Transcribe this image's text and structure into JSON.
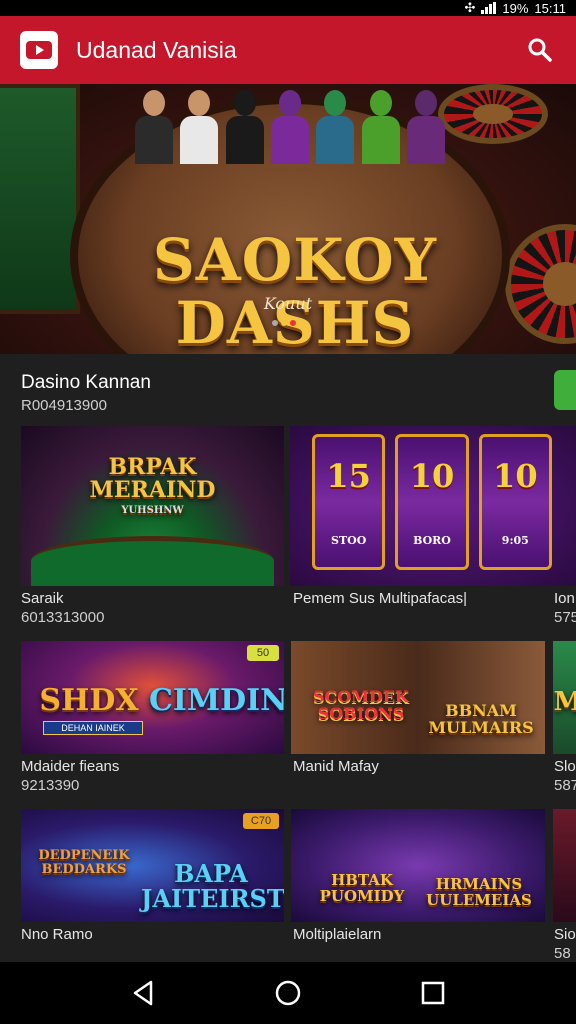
{
  "status_bar": {
    "battery_percent": "19%",
    "time": "15:11"
  },
  "app_bar": {
    "title": "Udanad Vanisia"
  },
  "hero": {
    "title_line1": "SAOKOY",
    "title_line2": "DASHS",
    "subtitle": "Kouut"
  },
  "section": {
    "title": "Dasino Kannan",
    "subtitle": "R004913900"
  },
  "tiles": [
    {
      "art_text": "BRPAK MERAIND",
      "art_sub": "YUHSHNW",
      "badge": "",
      "caption": "Saraik",
      "sub": "6013313000"
    },
    {
      "art_text": "",
      "reels": [
        {
          "num": "15",
          "lbl": "STOO"
        },
        {
          "num": "10",
          "lbl": "BORO"
        },
        {
          "num": "10",
          "lbl": "9:05"
        }
      ],
      "caption": "Pemem Sus Multipafacas|",
      "sub": ""
    },
    {
      "art_text": "Ion",
      "caption": "Ion",
      "sub": "575"
    },
    {
      "art_text": "SHDX",
      "art_text2": "CIMDING",
      "banner": "DEHAN IAINEK",
      "badge": "50",
      "caption": "Mdaider fieans",
      "sub": "9213390"
    },
    {
      "art_text": "SCOMDEK SOBIONS",
      "art_text2": "BBNAM MULMAIRS",
      "caption": "Manid Mafay",
      "sub": ""
    },
    {
      "art_text": "M",
      "caption": "Slo",
      "sub": "587"
    },
    {
      "art_text": "DEDPENEIK BEDDARKS",
      "art_text2": "BAPA JAITEIRST",
      "badge": "C70",
      "caption": "Nno Ramo",
      "sub": ""
    },
    {
      "art_text": "HBTAK PUOMIDY",
      "art_text2": "HRMAINS UULEMEIAS",
      "caption": "Moltiplaielarn",
      "sub": ""
    },
    {
      "art_text": "",
      "caption": "Sio",
      "sub": "58"
    }
  ],
  "colors": {
    "app_bar": "#c4172c",
    "background": "#1f1f1f",
    "gold_text": "#f5c542",
    "accent_green": "#3fae3a"
  },
  "icons": {
    "logo": "play-logo-icon",
    "search": "search-icon",
    "back": "back-triangle-icon",
    "home": "home-circle-icon",
    "recents": "recents-square-icon"
  }
}
